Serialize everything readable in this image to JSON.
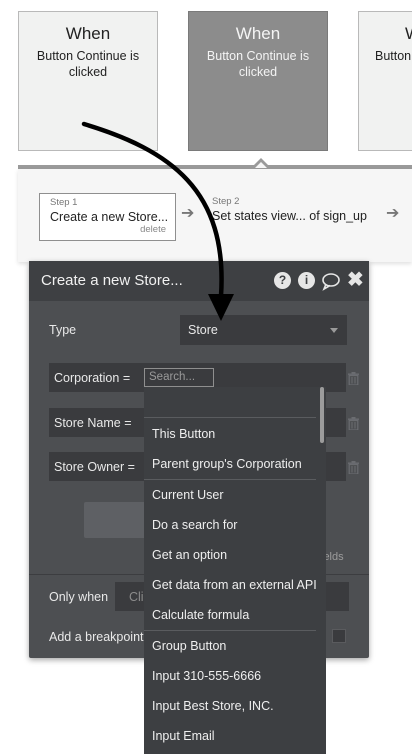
{
  "events": [
    {
      "title": "When",
      "description": "Button Continue is clicked",
      "selected": false
    },
    {
      "title": "When",
      "description": "Button Continue is clicked",
      "selected": true
    },
    {
      "title": "W",
      "description": "Button"
    }
  ],
  "workflow": {
    "steps": [
      {
        "label": "Step 1",
        "name": "Create a new Store...",
        "delete": "delete"
      },
      {
        "label": "Step 2",
        "name": "Set states view... of sign_up"
      }
    ],
    "arrow_glyph": "➔"
  },
  "panel": {
    "title": "Create a new Store...",
    "icons": {
      "help": "?",
      "info": "i",
      "comment": "comment-icon",
      "close": "✖"
    },
    "type_label": "Type",
    "type_value": "Store",
    "fields": [
      {
        "label": "Corporation",
        "operator": "="
      },
      {
        "label": "Store Name",
        "operator": "="
      },
      {
        "label": "Store Owner",
        "operator": "="
      }
    ],
    "search_placeholder": "Search...",
    "fields_link": "ields",
    "only_when_label": "Only when",
    "only_when_placeholder": "Cli",
    "breakpoint_label": "Add a breakpoint"
  },
  "dropdown": {
    "items": [
      "This Button",
      "Parent group's Corporation",
      "Current User",
      "Do a search for",
      "Get an option",
      "Get data from an external API",
      "Calculate formula",
      "Group Button",
      "Input 310-555-6666",
      "Input Best Store, INC.",
      "Input Email"
    ]
  },
  "colors": {
    "panel_bg": "#4d4f52",
    "panel_header": "#3e4043",
    "input_bg": "#3a3b3e",
    "selected_event": "#8c8c8c",
    "arrow": "#000000"
  }
}
